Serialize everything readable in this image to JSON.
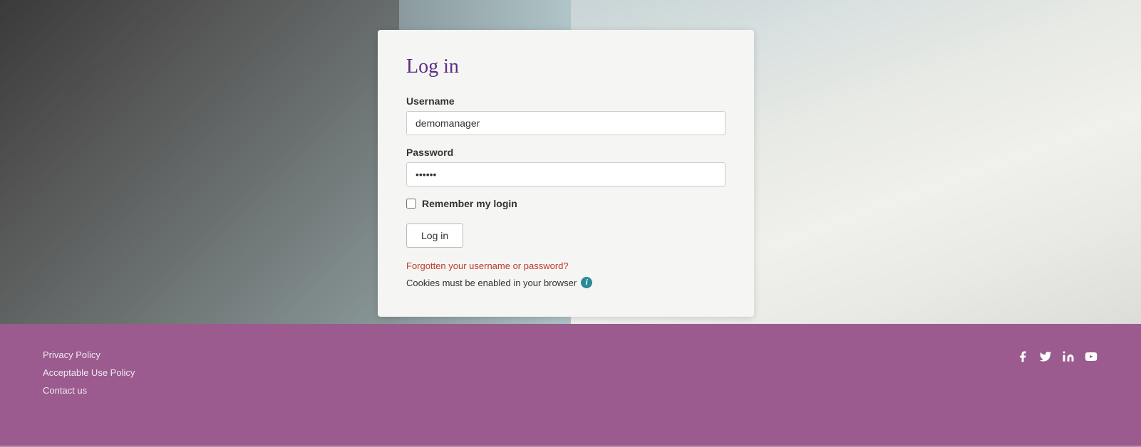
{
  "page": {
    "title": "Log in"
  },
  "login_form": {
    "title": "Log in",
    "username_label": "Username",
    "username_value": "demomanager",
    "username_placeholder": "demomanager",
    "password_label": "Password",
    "password_value": "••••••",
    "remember_label": "Remember my login",
    "login_button_label": "Log in",
    "forgot_link_label": "Forgotten your username or password?",
    "cookies_message": "Cookies must be enabled in your browser",
    "info_icon_label": "i"
  },
  "footer": {
    "links": [
      {
        "label": "Privacy Policy"
      },
      {
        "label": "Acceptable Use Policy"
      },
      {
        "label": "Contact us"
      }
    ],
    "social_icons": [
      {
        "name": "facebook-icon",
        "symbol": "f"
      },
      {
        "name": "twitter-icon",
        "symbol": "t"
      },
      {
        "name": "linkedin-icon",
        "symbol": "in"
      },
      {
        "name": "youtube-icon",
        "symbol": "▶"
      }
    ]
  }
}
